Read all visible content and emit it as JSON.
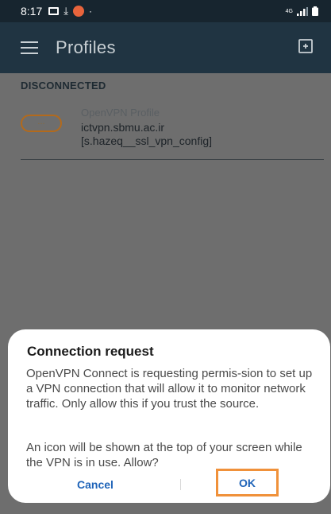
{
  "status_bar": {
    "time": "8:17",
    "dot": "·",
    "network": "4G",
    "icons": [
      "image-icon",
      "download-icon",
      "app-badge-icon",
      "signal-icon",
      "battery-icon"
    ]
  },
  "app_bar": {
    "title": "Profiles",
    "icons": [
      "menu-icon",
      "import-icon"
    ]
  },
  "profiles": {
    "section_header": "DISCONNECTED",
    "items": [
      {
        "type_label": "OpenVPN Profile",
        "host": "ictvpn.sbmu.ac.ir",
        "name": "[s.hazeq__ssl_vpn_config]",
        "toggle_state": "off"
      }
    ]
  },
  "dialog": {
    "title": "Connection request",
    "message1": "OpenVPN Connect is requesting permis-sion to set up a VPN connection that will allow it to monitor network traffic. Only allow this if you trust the source.",
    "message2": "An icon will be shown at the top of your screen while the VPN is in use. Allow?",
    "cancel_label": "Cancel",
    "ok_label": "OK"
  },
  "colors": {
    "status_bar_bg": "#17252f",
    "app_bar_bg": "#203442",
    "scrim_bg": "#6e6e6e",
    "button_text": "#1e63b8",
    "highlight_border": "#f0913a",
    "toggle_border": "#b36a1c"
  }
}
